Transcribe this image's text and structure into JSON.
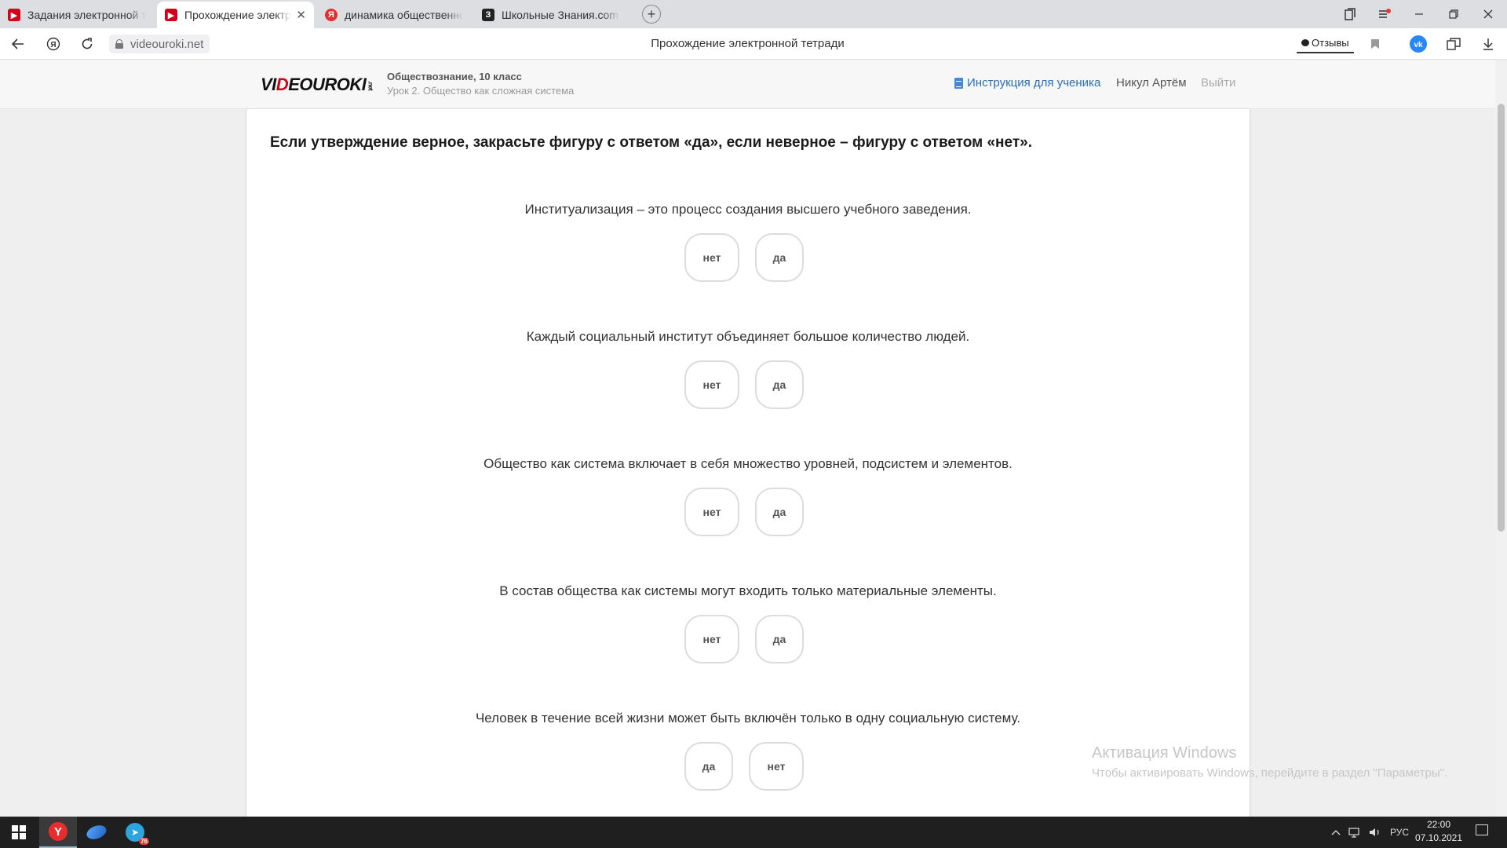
{
  "browser": {
    "tabs": [
      {
        "title": "Задания электронной тетр",
        "favicon": "videouroki-icon",
        "active": false
      },
      {
        "title": "Прохождение электрон",
        "favicon": "videouroki-icon",
        "active": true,
        "close": "✕"
      },
      {
        "title": "динамика общественного",
        "favicon": "yandex-icon",
        "active": false
      },
      {
        "title": "Школьные Знания.com - П",
        "favicon": "znanija-icon",
        "active": false
      }
    ],
    "new_tab": "+",
    "url": "videouroki.net",
    "page_title": "Прохождение электронной тетради",
    "feedback_label": "Отзывы"
  },
  "site": {
    "logo_pre": "VI",
    "logo_red": "D",
    "logo_post": "EOUROKI",
    "logo_net": ".net",
    "course": "Обществознание, 10 класс",
    "lesson": "Урок 2. Общество как сложная система",
    "instruction_link": "Инструкция для ученика",
    "user": "Никул Артём",
    "logout": "Выйти"
  },
  "task": {
    "instruction": "Если утверждение верное, закрасьте фигуру с ответом «да», если неверное – фигуру с ответом «нет».",
    "questions": [
      {
        "text": "Институализация – это процесс создания высшего учебного заведения.",
        "options": [
          "нет",
          "да"
        ]
      },
      {
        "text": "Каждый социальный институт объединяет большое количество людей.",
        "options": [
          "нет",
          "да"
        ]
      },
      {
        "text": "Общество как система включает в себя множество уровней, подсистем и элементов.",
        "options": [
          "нет",
          "да"
        ]
      },
      {
        "text": "В состав общества как системы могут входить только материальные элементы.",
        "options": [
          "нет",
          "да"
        ]
      },
      {
        "text": "Человек в течение всей жизни может быть включён только в одну социальную систему.",
        "options": [
          "да",
          "нет"
        ]
      }
    ]
  },
  "watermark": {
    "title": "Активация Windows",
    "subtitle": "Чтобы активировать Windows, перейдите в раздел \"Параметры\"."
  },
  "taskbar": {
    "telegram_badge": "76",
    "language": "РУС",
    "time": "22:00",
    "date": "07.10.2021"
  },
  "colors": {
    "accent_link": "#2a6fb7",
    "logo_red": "#d0021b",
    "taskbar": "#1f1f1f"
  }
}
